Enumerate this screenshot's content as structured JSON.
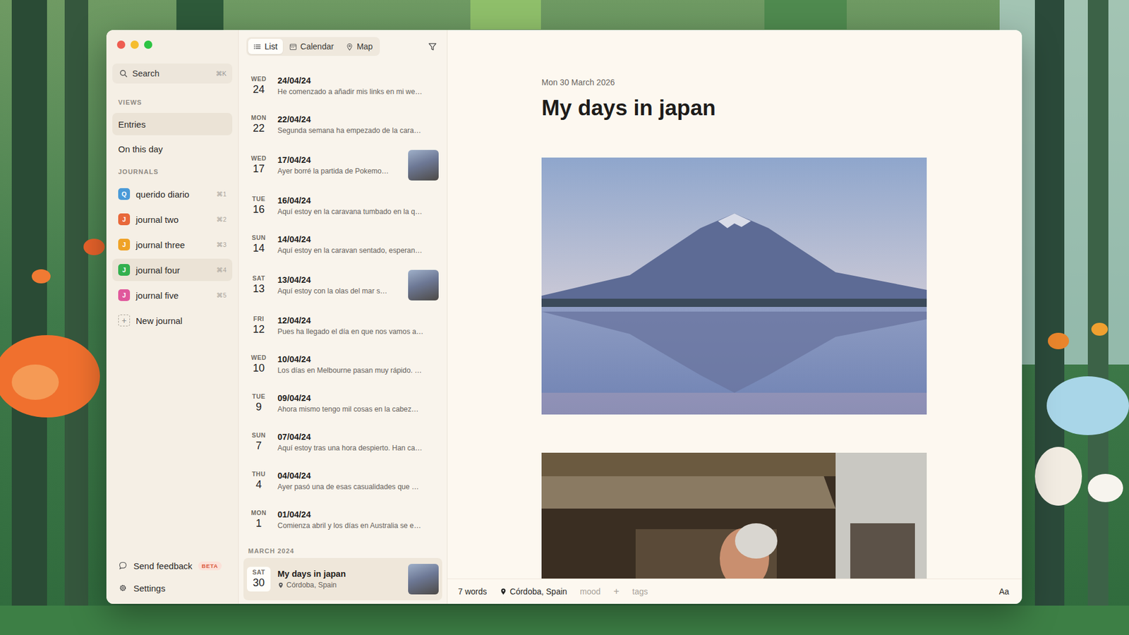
{
  "sidebar": {
    "search": {
      "placeholder": "Search",
      "shortcut": "⌘K"
    },
    "views_heading": "VIEWS",
    "views": [
      {
        "label": "Entries",
        "selected": true
      },
      {
        "label": "On this day",
        "selected": false
      }
    ],
    "journals_heading": "JOURNALS",
    "journals": [
      {
        "label": "querido diario",
        "letter": "Q",
        "shortcut": "⌘1",
        "color": "#4a9ad8",
        "selected": false
      },
      {
        "label": "journal two",
        "letter": "J",
        "shortcut": "⌘2",
        "color": "#e8683a",
        "selected": false
      },
      {
        "label": "journal three",
        "letter": "J",
        "shortcut": "⌘3",
        "color": "#efa227",
        "selected": false
      },
      {
        "label": "journal four",
        "letter": "J",
        "shortcut": "⌘4",
        "color": "#33b04f",
        "selected": true
      },
      {
        "label": "journal five",
        "letter": "J",
        "shortcut": "⌘5",
        "color": "#e0589c",
        "selected": false
      }
    ],
    "new_journal": {
      "icon": "+",
      "label": "New journal"
    },
    "feedback": {
      "label": "Send feedback",
      "badge": "BETA"
    },
    "settings": {
      "label": "Settings"
    }
  },
  "list": {
    "tabs": [
      {
        "label": "List",
        "selected": true
      },
      {
        "label": "Calendar",
        "selected": false
      },
      {
        "label": "Map",
        "selected": false
      }
    ],
    "entries": [
      {
        "weekday": "WED",
        "day": "24",
        "title": "24/04/24",
        "kind": "excerpt",
        "excerpt": "He comenzado a añadir mis links en mi we…",
        "photo": false,
        "selected": false
      },
      {
        "weekday": "MON",
        "day": "22",
        "title": "22/04/24",
        "kind": "excerpt",
        "excerpt": "Segunda semana ha empezado de la cara…",
        "photo": false,
        "selected": false
      },
      {
        "weekday": "WED",
        "day": "17",
        "title": "17/04/24",
        "kind": "excerpt",
        "excerpt": "Ayer borré la partida de Pokemo…",
        "photo": true,
        "selected": false
      },
      {
        "weekday": "TUE",
        "day": "16",
        "title": "16/04/24",
        "kind": "excerpt",
        "excerpt": "Aquí estoy en la caravana tumbado en la q…",
        "photo": false,
        "selected": false
      },
      {
        "weekday": "SUN",
        "day": "14",
        "title": "14/04/24",
        "kind": "excerpt",
        "excerpt": "Aquí estoy en la caravan sentado, esperan…",
        "photo": false,
        "selected": false
      },
      {
        "weekday": "SAT",
        "day": "13",
        "title": "13/04/24",
        "kind": "excerpt",
        "excerpt": "Aquí estoy con la olas del mar s…",
        "photo": true,
        "selected": false
      },
      {
        "weekday": "FRI",
        "day": "12",
        "title": "12/04/24",
        "kind": "excerpt",
        "excerpt": "Pues ha llegado el día en que nos vamos a…",
        "photo": false,
        "selected": false
      },
      {
        "weekday": "WED",
        "day": "10",
        "title": "10/04/24",
        "kind": "excerpt",
        "excerpt": "Los días en Melbourne pasan muy rápido. …",
        "photo": false,
        "selected": false
      },
      {
        "weekday": "TUE",
        "day": "9",
        "title": "09/04/24",
        "kind": "excerpt",
        "excerpt": "Ahora mismo tengo mil cosas en la cabez…",
        "photo": false,
        "selected": false
      },
      {
        "weekday": "SUN",
        "day": "7",
        "title": "07/04/24",
        "kind": "excerpt",
        "excerpt": "Aquí estoy tras una hora despierto. Han ca…",
        "photo": false,
        "selected": false
      },
      {
        "weekday": "THU",
        "day": "4",
        "title": "04/04/24",
        "kind": "excerpt",
        "excerpt": "Ayer pasó una de esas casualidades que …",
        "photo": false,
        "selected": false
      },
      {
        "weekday": "MON",
        "day": "1",
        "title": "01/04/24",
        "kind": "excerpt",
        "excerpt": "Comienza abril y los días en Australia se e…",
        "photo": false,
        "selected": false
      }
    ],
    "month_section": {
      "heading": "MARCH 2024",
      "entries": [
        {
          "weekday": "SAT",
          "day": "30",
          "title": "My days in japan",
          "kind": "location",
          "location": "Córdoba, Spain",
          "photo": true,
          "selected": true
        }
      ]
    }
  },
  "entry": {
    "date": "Mon 30 March 2026",
    "title": "My days in japan"
  },
  "status_bar": {
    "words": "7 words",
    "location": "Córdoba, Spain",
    "mood": "mood",
    "add": "+",
    "tags": "tags",
    "format": "Aa"
  }
}
